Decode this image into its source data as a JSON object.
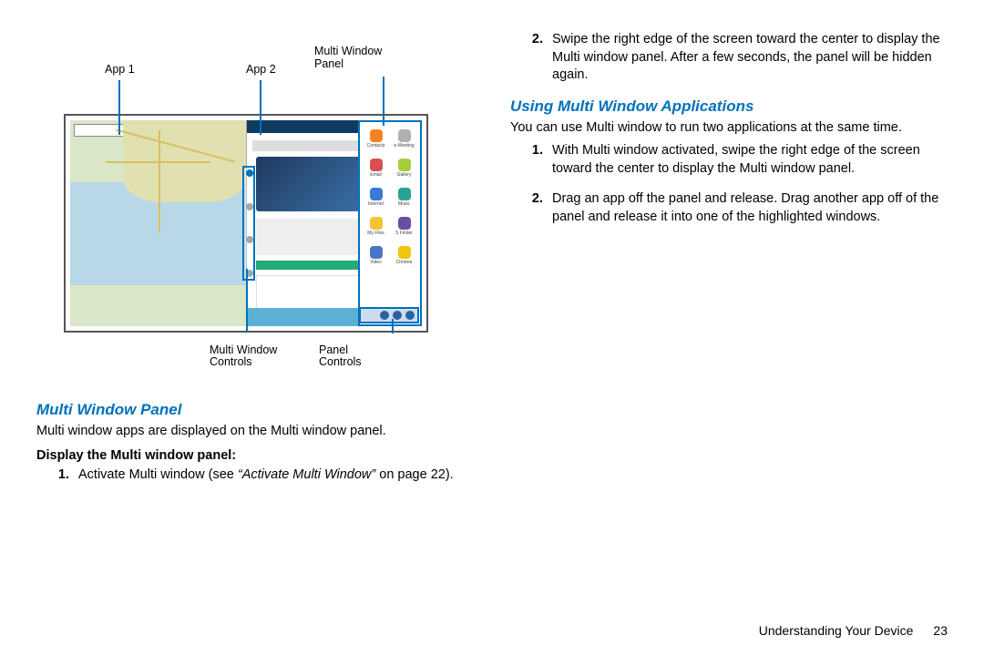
{
  "figure": {
    "labels": {
      "app1": "App 1",
      "app2": "App 2",
      "mw_panel": "Multi Window\nPanel",
      "mw_controls": "Multi Window\nControls",
      "panel_controls": "Panel\nControls"
    },
    "panel_apps": [
      {
        "name": "Contacts",
        "color": "#f58220"
      },
      {
        "name": "e-Meeting",
        "color": "#b0b0b0"
      },
      {
        "name": "Email",
        "color": "#d94f4f"
      },
      {
        "name": "Gallery",
        "color": "#a6ce39"
      },
      {
        "name": "Internet",
        "color": "#3a7bd5"
      },
      {
        "name": "Music",
        "color": "#2aa198"
      },
      {
        "name": "My Files",
        "color": "#f4c430"
      },
      {
        "name": "S Finder",
        "color": "#6a4fa0"
      },
      {
        "name": "Video",
        "color": "#4a76c9"
      },
      {
        "name": "Chrome",
        "color": "#f1c40f"
      }
    ]
  },
  "left": {
    "heading1": "Multi Window Panel",
    "para1": "Multi window apps are displayed on the Multi window panel.",
    "subhead1": "Display the Multi window panel:",
    "step1_pre": "Activate Multi window (see ",
    "step1_ref": "“Activate Multi Window”",
    "step1_post": " on page 22)."
  },
  "right": {
    "step2": "Swipe the right edge of the screen toward the center to display the Multi window panel. After a few seconds, the panel will be hidden again.",
    "heading2": "Using Multi Window Applications",
    "para2": "You can use Multi window to run two applications at the same time.",
    "r_step1": "With Multi window activated, swipe the right edge of the screen toward the center to display the Multi window panel.",
    "r_step2": "Drag an app off the panel and release. Drag another app off of the panel and release it into one of the highlighted windows."
  },
  "footer": {
    "section": "Understanding Your Device",
    "page": "23"
  }
}
